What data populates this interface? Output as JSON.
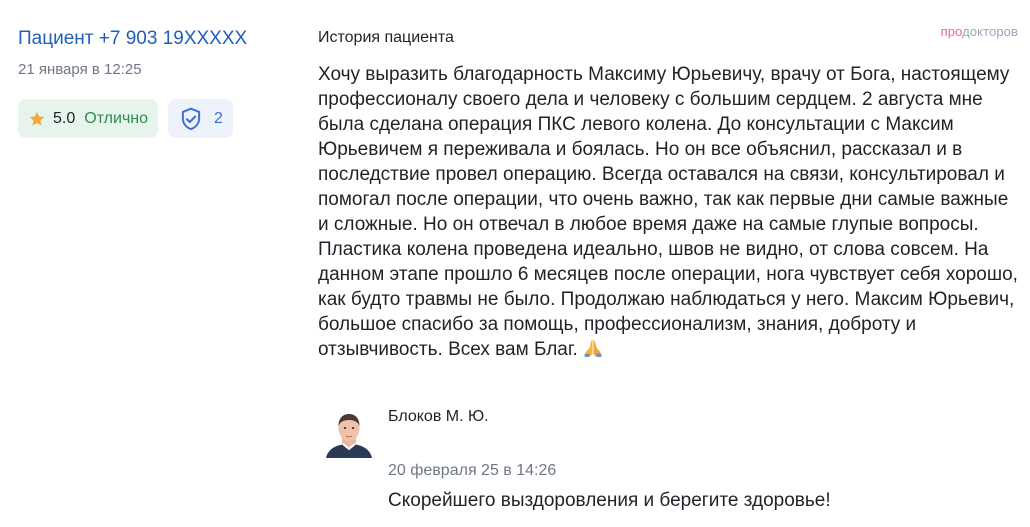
{
  "brand": {
    "pro": "про",
    "rest": "докторов",
    "accent_color": "#ec6a8b"
  },
  "patient": {
    "name": "Пациент +7 903 19XXXXX",
    "date": "21 января в 12:25"
  },
  "rating": {
    "score": "5.0",
    "label": "Отлично",
    "icon": "star-icon",
    "bg_color": "#e6f4ec"
  },
  "verified": {
    "count": "2",
    "icon": "shield-check-icon",
    "color": "#3b6fd6"
  },
  "review": {
    "section_title": "История пациента",
    "text": "Хочу выразить благодарность Максиму Юрьевичу, врачу от Бога, настоящему профессионалу своего дела и человеку с большим сердцем. 2 августа мне была сделана операция ПКС левого колена. До консультации с Максим Юрьевичем я переживала и боялась. Но он все объяснил, рассказал и в последствие провел операцию. Всегда оставался на связи, консультировал и помогал после операции, что очень важно, так как первые дни самые важные и сложные. Но он отвечал в любое время даже на самые глупые вопросы. Пластика колена проведена идеально, швов не видно, от слова совсем. На данном этапе прошло 6 месяцев после операции, нога чувствует себя хорошо, как будто травмы не было. Продолжаю наблюдаться у него. Максим Юрьевич, большое спасибо за помощь, профессионализм, знания, доброту и отзывчивость. Всех вам Благ.",
    "emoji": "folded-hands-icon"
  },
  "reply": {
    "doctor_name": "Блоков М. Ю.",
    "date": "20 февраля 25 в 14:26",
    "text": "Скорейшего выздоровления и берегите здоровье!"
  }
}
